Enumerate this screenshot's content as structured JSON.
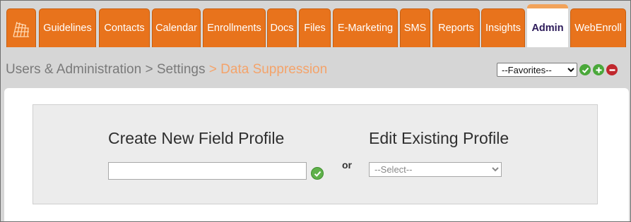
{
  "nav": {
    "tabs": [
      {
        "label": "Guidelines"
      },
      {
        "label": "Contacts"
      },
      {
        "label": "Calendar"
      },
      {
        "label": "Enrollments"
      },
      {
        "label": "Docs"
      },
      {
        "label": "Files"
      },
      {
        "label": "E-Marketing"
      },
      {
        "label": "SMS"
      },
      {
        "label": "Reports"
      },
      {
        "label": "Insights"
      },
      {
        "label": "Admin",
        "active": true
      },
      {
        "label": "WebEnroll"
      }
    ],
    "logo_icon": "stadium-grid-logo",
    "accent_color": "#e8731c"
  },
  "breadcrumb": {
    "part1": "Users & Administration",
    "sep1": " > ",
    "part2": "Settings",
    "sep2": " > ",
    "current": "Data Suppression",
    "current_color": "#f4a36a"
  },
  "favorites": {
    "selected": "--Favorites--",
    "actions": [
      "check-icon",
      "add-icon",
      "remove-icon"
    ]
  },
  "form": {
    "create_heading": "Create New Field Profile",
    "create_value": "",
    "or_label": "or",
    "edit_heading": "Edit Existing Profile",
    "edit_selected": "--Select--"
  }
}
